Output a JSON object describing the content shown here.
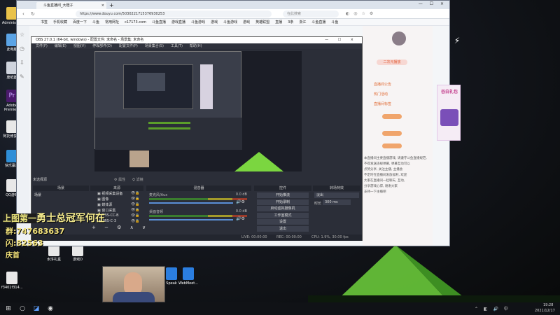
{
  "desktop_icons": [
    {
      "label": "Administr...",
      "color": "#e9c24a"
    },
    {
      "label": "此电脑",
      "color": "#5ba4e6"
    },
    {
      "label": "废纸篓",
      "color": "#cfd4dd"
    },
    {
      "label": "Adobe Premie...",
      "color": "#4a1a6b"
    },
    {
      "label": "阿托修复站",
      "color": "#e8e8e8"
    },
    {
      "label": "快乐赢单",
      "color": "#2f8fd8"
    },
    {
      "label": "QQ游戏",
      "color": "#e8e8e8"
    }
  ],
  "browser": {
    "tab_title": "斗鱼直播间_大橙子",
    "url_label": "https://www.douyu.com/5030221715376930253",
    "search_placeholder": "在此搜索",
    "bookmarks": [
      "书签",
      "手机收藏",
      "百度一下",
      "斗鱼",
      "常用网址",
      "c17173.com",
      "斗鱼直播",
      "游戏直播",
      "斗鱼游戏",
      "游戏",
      "斗鱼游戏",
      "游戏",
      "英雄联盟",
      "直播",
      "3条",
      "浙江",
      "斗鱼直播",
      "斗鱼"
    ],
    "panel": {
      "btn1": "二次元播放",
      "lines": [
        "直播间公告",
        "热门活动",
        "直播间标签"
      ],
      "paragraph": [
        "本直播间主要直播游戏, 请遵守斗鱼直播规范,",
        "不得发送违规弹幕, 弹幕互动可以",
        "点赞分享, 关注主播, 主播会",
        "不定时在直播间发放福利, 欢迎",
        "大家在直播间一起聊天, 互动,",
        "分享游戏心得, 谢谢大家",
        "",
        "支持一下主播吧"
      ],
      "badge": "谷白礼包"
    }
  },
  "obs": {
    "title": "OBS 27.0.1 (64-bit, windows) - 配置文件: 未命名 - 场景集: 未命名",
    "menu": [
      "文件(F)",
      "编辑(E)",
      "视图(V)",
      "停靠部件(D)",
      "配置文件(P)",
      "场景集合(S)",
      "工具(T)",
      "帮助(H)"
    ],
    "source_label": "未选择源",
    "panel_titles": [
      "场景",
      "来源",
      "混音器",
      "控件",
      "转场特效"
    ],
    "scenes": [
      "场景"
    ],
    "sources": [
      "视频采集设备",
      "图像",
      "媒体源",
      "窗口采集",
      "OBS-CC-B",
      "OBS-C-3"
    ],
    "mixer": [
      {
        "name": "麦克风/Aux",
        "db": "0.0 dB"
      },
      {
        "name": "桌面音频",
        "db": "0.0 dB"
      }
    ],
    "controls": [
      "开始推流",
      "开始录制",
      "启动虚拟摄像机",
      "工作室模式",
      "设置",
      "退出"
    ],
    "transition": {
      "label": "淡出",
      "duration_label": "时长",
      "duration": "300 ms"
    },
    "status": {
      "live": "LIVE: 00:00:00",
      "rec": "REC: 00:00:00",
      "cpu": "CPU: 1.9%, 30.00 fps"
    }
  },
  "overlay": {
    "title1": "上图第一",
    "title2": "勇士总冠军何在",
    "line1_prefix": "群:",
    "line1": "747683637",
    "line2_prefix": "闪:",
    "line2": "82563",
    "line3": "庆首"
  },
  "desktop_icons2": [
    {
      "label": "水浒礼盒",
      "color": "#e8e8e8"
    },
    {
      "label": "游戏D",
      "color": "#e8e8e8"
    },
    {
      "label": "f3401f314...",
      "color": "#e8e8e8"
    },
    {
      "label": "Speak",
      "color": "#2b7ee0"
    },
    {
      "label": "WebMeet...",
      "color": "#2b7ee0"
    }
  ],
  "taskbar": {
    "icons": [
      "windows",
      "search",
      "task-view",
      "edge",
      "obs"
    ],
    "time": "19:28",
    "date": "2021/12/17"
  }
}
